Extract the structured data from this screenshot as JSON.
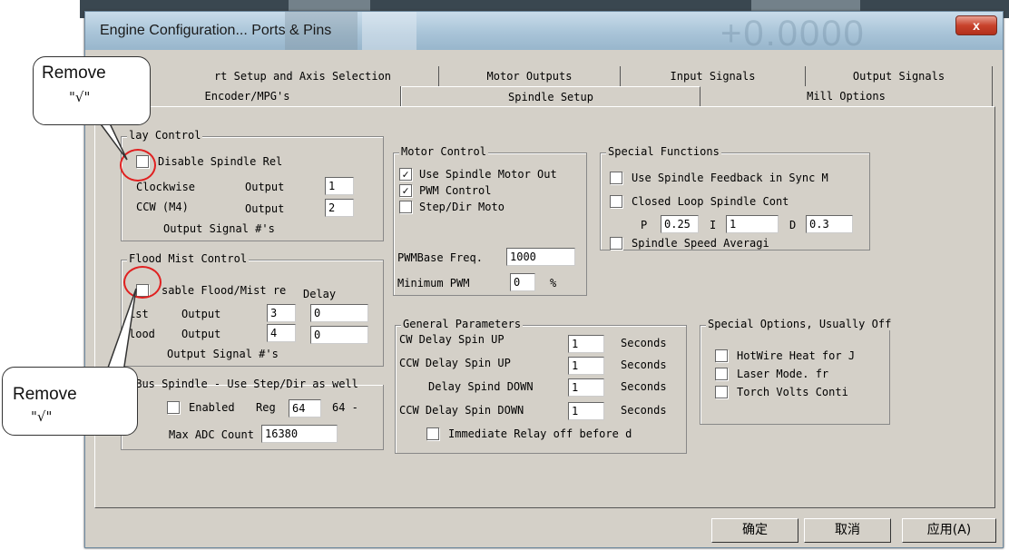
{
  "window": {
    "title": "Engine Configuration... Ports & Pins",
    "ghost_text": "+0.0000",
    "close_label": "x"
  },
  "tabs_row1": [
    "Port Setup and Axis Selection",
    "Motor Outputs",
    "Input Signals",
    "Output Signals"
  ],
  "tabs_row1_visible": [
    "rt Setup and Axis Selection",
    "Motor Outputs",
    "Input Signals",
    "Output Signals"
  ],
  "tabs_row2": [
    "Encoder/MPG's",
    "Spindle Setup",
    "Mill Options"
  ],
  "active_tab": "Spindle Setup",
  "relay_control": {
    "legend": "lay Control",
    "disable_label": "Disable Spindle Rel",
    "disable_checked": false,
    "cw_label": "Clockwise",
    "ccw_label": "CCW (M4)",
    "output_label": "Output",
    "cw_value": "1",
    "ccw_value": "2",
    "signal_label": "Output Signal #'s"
  },
  "flood_mist": {
    "legend": "Flood Mist Control",
    "disable_label": "Disable Flood/Mist re",
    "disable_label_vis": "sable Flood/Mist re",
    "disable_checked": false,
    "delay_label": "Delay",
    "mist_label": "Mist",
    "mist_label_vis": "ist",
    "flood_label": "Flood",
    "flood_label_vis": "lood",
    "output_label": "Output",
    "mist_output": "3",
    "mist_delay": "0",
    "flood_output": "4",
    "flood_delay": "0",
    "signal_label": "Output Signal #'s"
  },
  "modbus": {
    "legend": "dBus Spindle - Use Step/Dir as well",
    "enabled_label": "Enabled",
    "enabled_checked": false,
    "reg_label": "Reg",
    "reg_value": "64",
    "reg_suffix": "64 -",
    "max_adc_label": "Max ADC Count",
    "max_adc_value": "16380"
  },
  "motor_control": {
    "legend": "Motor Control",
    "use_spindle_motor_label": "Use Spindle Motor Out",
    "use_spindle_motor_checked": true,
    "pwm_label": "PWM Control",
    "pwm_checked": true,
    "stepdir_label": "Step/Dir Moto",
    "stepdir_checked": false,
    "pwmbase_label": "PWMBase Freq.",
    "pwmbase_value": "1000",
    "minpwm_label": "Minimum PWM",
    "minpwm_value": "0",
    "minpwm_unit": "%"
  },
  "special_functions": {
    "legend": "Special Functions",
    "feedback_label": "Use Spindle Feedback in Sync M",
    "feedback_checked": false,
    "closed_loop_label": "Closed Loop Spindle Cont",
    "closed_loop_checked": false,
    "p_label": "P",
    "p_value": "0.25",
    "i_label": "I",
    "i_value": "1",
    "d_label": "D",
    "d_value": "0.3",
    "averaging_label": "Spindle Speed Averagi",
    "averaging_checked": false
  },
  "general_params": {
    "legend": "General Parameters",
    "rows": [
      {
        "label": "CW Delay Spin UP",
        "value": "1",
        "unit": "Seconds"
      },
      {
        "label": "CCW Delay Spin UP",
        "value": "1",
        "unit": "Seconds"
      },
      {
        "label": "CW Delay Spind DOWN",
        "value": "1",
        "unit": "Seconds"
      },
      {
        "label": "CCW Delay Spin DOWN",
        "value": "1",
        "unit": "Seconds"
      }
    ],
    "row3_visible": "Delay Spind DOWN",
    "immediate_label": "Immediate Relay off before d",
    "immediate_checked": false
  },
  "special_options": {
    "legend": "Special Options, Usually Off",
    "items": [
      {
        "label": "HotWire Heat for J",
        "checked": false
      },
      {
        "label": "Laser Mode. fr",
        "checked": false
      },
      {
        "label": "Torch Volts Conti",
        "checked": false
      }
    ]
  },
  "buttons": {
    "ok": "确定",
    "cancel": "取消",
    "apply": "应用(A)"
  },
  "annotations": [
    {
      "word": "Remove",
      "symbol": "\"√\""
    },
    {
      "word": "Remove",
      "symbol": "\"√\""
    }
  ],
  "colors": {
    "dialog_bg": "#d4d0c8",
    "highlight_ring": "#e02020",
    "close_button": "#c8432c"
  }
}
